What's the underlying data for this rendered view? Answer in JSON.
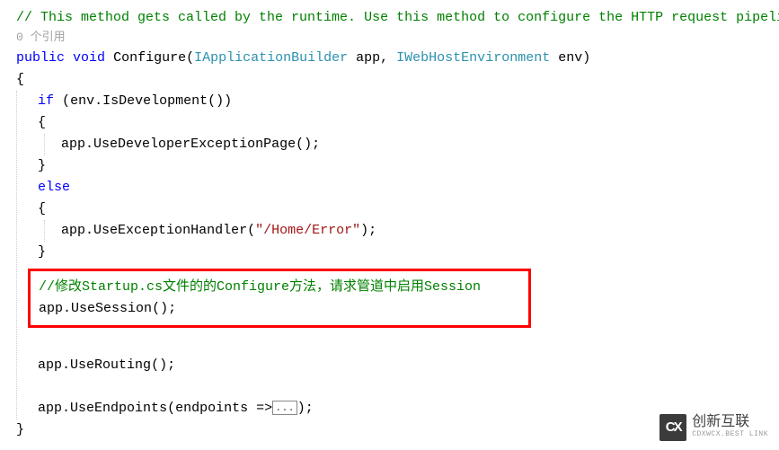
{
  "code": {
    "comment_top": "// This method gets called by the runtime. Use this method to configure the HTTP request pipeline.",
    "codelens": "0 个引用",
    "kw_public": "public",
    "kw_void": "void",
    "method_name": "Configure",
    "param1_type": "IApplicationBuilder",
    "param1_name": "app",
    "param2_type": "IWebHostEnvironment",
    "param2_name": "env",
    "brace_open": "{",
    "brace_close": "}",
    "kw_if": "if",
    "if_cond_obj": "env",
    "if_cond_method": "IsDevelopment",
    "use_dev_obj": "app",
    "use_dev_method": "UseDeveloperExceptionPage",
    "kw_else": "else",
    "use_exh_obj": "app",
    "use_exh_method": "UseExceptionHandler",
    "use_exh_arg": "\"/Home/Error\"",
    "hl_comment": "//修改Startup.cs文件的的Configure方法，请求管道中启用Session",
    "hl_obj": "app",
    "hl_method": "UseSession",
    "use_routing_obj": "app",
    "use_routing_method": "UseRouting",
    "use_endpoints_obj": "app",
    "use_endpoints_method": "UseEndpoints",
    "use_endpoints_param": "endpoints",
    "lambda_arrow": " =>",
    "collapsed": "...",
    "semicolon_paren": ");",
    "semicolon": "();",
    "paren_open": "(",
    "paren_close": ")",
    "dot": "."
  },
  "watermark": {
    "icon": "CX",
    "text": "创新互联",
    "sub": "CDXWCX.BEST LINK"
  }
}
